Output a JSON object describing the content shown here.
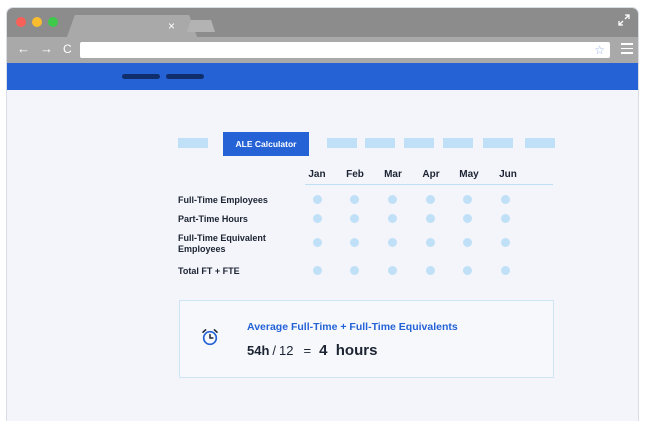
{
  "browser": {
    "tab_close": "×",
    "nav_back": "←",
    "nav_forward": "→",
    "nav_reload": "C",
    "url": "",
    "star": "☆"
  },
  "calculator": {
    "active_tab_label": "ALE Calculator",
    "months": [
      "Jan",
      "Feb",
      "Mar",
      "Apr",
      "May",
      "Jun"
    ],
    "rows": [
      "Full-Time Employees",
      "Part-Time Hours",
      "Full-Time Equivalent Employees",
      "Total FT + FTE"
    ]
  },
  "summary": {
    "title": "Average Full-Time + Full-Time Equivalents",
    "numerator": "54h",
    "slash": "/",
    "denominator": "12",
    "equals": "=",
    "result": "4  hours"
  },
  "colors": {
    "accent": "#2462d6",
    "placeholder": "#bfe0f6",
    "text": "#1c2433"
  }
}
